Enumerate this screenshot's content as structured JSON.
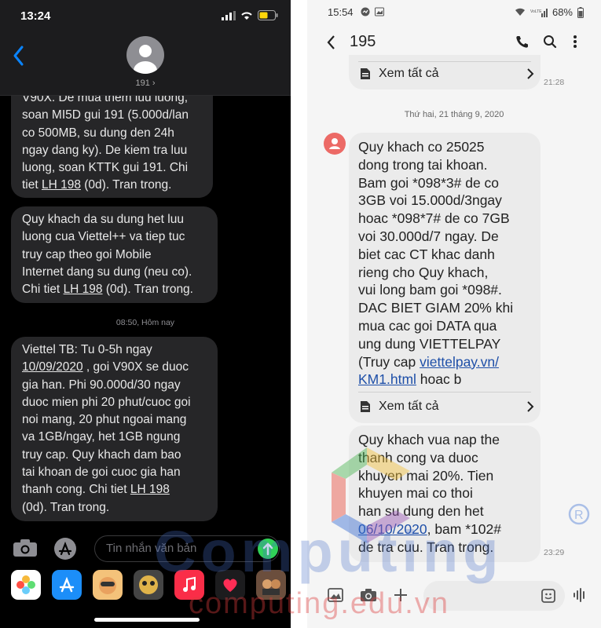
{
  "left": {
    "status": {
      "time": "13:24"
    },
    "contact": {
      "name": "191 ›"
    },
    "messages": [
      {
        "lines": [
          "V90X. De mua them luu luong,",
          "soan MI5D gui 191 (5.000d/lan",
          "co 500MB, su dung den 24h",
          "ngay dang ky). De kiem tra luu",
          "luong, soan KTTK gui 191. Chi"
        ],
        "tail_pre": "tiet ",
        "tail_link": "LH 198",
        "tail_post": " (0d). Tran trong."
      },
      {
        "lines": [
          "Quy khach da su dung het luu",
          "luong cua Viettel++ va tiep tuc",
          "truy cap theo goi Mobile",
          "Internet dang su dung (neu co)."
        ],
        "tail_pre": "Chi tiet ",
        "tail_link": "LH 198",
        "tail_post": " (0d). Tran trong."
      },
      {
        "l1": "Viettel TB: Tu 0-5h ngay",
        "l2_link": "10/09/2020",
        "l2_post": " , goi V90X se duoc",
        "lines": [
          "gia han. Phi 90.000d/30 ngay",
          "duoc mien phi 20 phut/cuoc goi",
          "noi mang, 20 phut ngoai mang",
          "va 1GB/ngay, het 1GB ngung",
          "truy cap. Quy khach dam bao",
          "tai khoan de goi cuoc gia han"
        ],
        "l9_pre": "thanh cong. Chi tiet ",
        "l9_link": "LH 198",
        "l10": "(0d). Tran trong."
      }
    ],
    "timestamp": "08:50, Hôm nay",
    "input_placeholder": "Tin nhắn văn bản"
  },
  "right": {
    "status": {
      "time": "15:54",
      "battery": "68%"
    },
    "title": "195",
    "see_all": "Xem tất cả",
    "first_time": "21:28",
    "date_separator": "Thứ hai, 21 tháng 9, 2020",
    "msg1": {
      "lines": [
        "Quy khach co 25025",
        "dong trong tai khoan.",
        "Bam goi *098*3# de co",
        "3GB voi 15.000d/3ngay",
        "hoac *098*7# de co 7GB",
        "voi 30.000d/7 ngay. De",
        "biet cac CT khac danh",
        "rieng cho Quy khach,",
        "vui long bam goi *098#.",
        "DAC BIET GIAM 20% khi",
        "mua cac goi DATA qua",
        "ung dung VIETTELPAY"
      ],
      "l13_pre": "(Truy cap ",
      "l13_link": "viettelpay.vn/",
      "l14_link": "KM1.html",
      "l14_post": " hoac b"
    },
    "msg2": {
      "lines": [
        "Quy khach vua nap the",
        "thanh cong va duoc",
        "khuyen mai 20%. Tien",
        "khuyen mai co thoi",
        "han su dung den het"
      ],
      "l6_link": "06/10/2020",
      "l6_post": ", bam *102#",
      "l7": "de tra cuu. Tran trong."
    },
    "msg2_time": "23:29"
  },
  "watermark": {
    "big": "Computing",
    "small": "computing.edu.vn"
  },
  "colors": {
    "ios_bg": "#000000",
    "ios_bubble": "#262628",
    "ios_send": "#30d158",
    "sam_bubble": "#ebebeb",
    "sam_avatar": "#ec6a66",
    "link": "#1e4fa8"
  }
}
